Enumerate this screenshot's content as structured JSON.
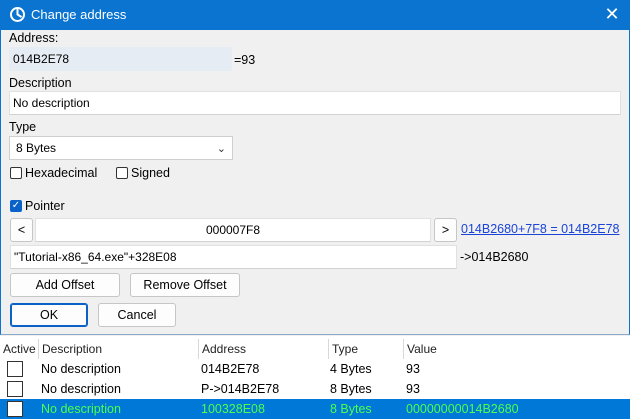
{
  "window": {
    "title": "Change address",
    "close_glyph": "✕",
    "icon": "cheat-engine-icon"
  },
  "address": {
    "label": "Address:",
    "value": "014B2E78",
    "result": "=93"
  },
  "description": {
    "label": "Description",
    "value": "No description"
  },
  "type": {
    "label": "Type",
    "selected": "8 Bytes",
    "chevron": "⌄"
  },
  "options": {
    "hexadecimal": "Hexadecimal",
    "signed": "Signed",
    "pointer": "Pointer",
    "pointer_checked": true
  },
  "pointer": {
    "prev_label": "<",
    "next_label": ">",
    "offset": "000007F8",
    "offset_link": "014B2680+7F8 = 014B2E78",
    "base": "\"Tutorial-x86_64.exe\"+328E08",
    "base_result": "->014B2680"
  },
  "buttons": {
    "add_offset": "Add Offset",
    "remove_offset": "Remove Offset",
    "ok": "OK",
    "cancel": "Cancel"
  },
  "table": {
    "columns": [
      "Active",
      "Description",
      "Address",
      "Type",
      "Value"
    ],
    "rows": [
      {
        "description": "No description",
        "address": "014B2E78",
        "type": "4 Bytes",
        "value": "93"
      },
      {
        "description": "No description",
        "address": "P->014B2E78",
        "type": "8 Bytes",
        "value": "93"
      },
      {
        "description": "No description",
        "address": "100328E08",
        "type": "8 Bytes",
        "value": "00000000014B2680"
      }
    ]
  },
  "colors": {
    "titlebar": "#0a74d0",
    "selection": "#0078d7",
    "selection_text": "#4cff4c",
    "link": "#1a44d8"
  }
}
